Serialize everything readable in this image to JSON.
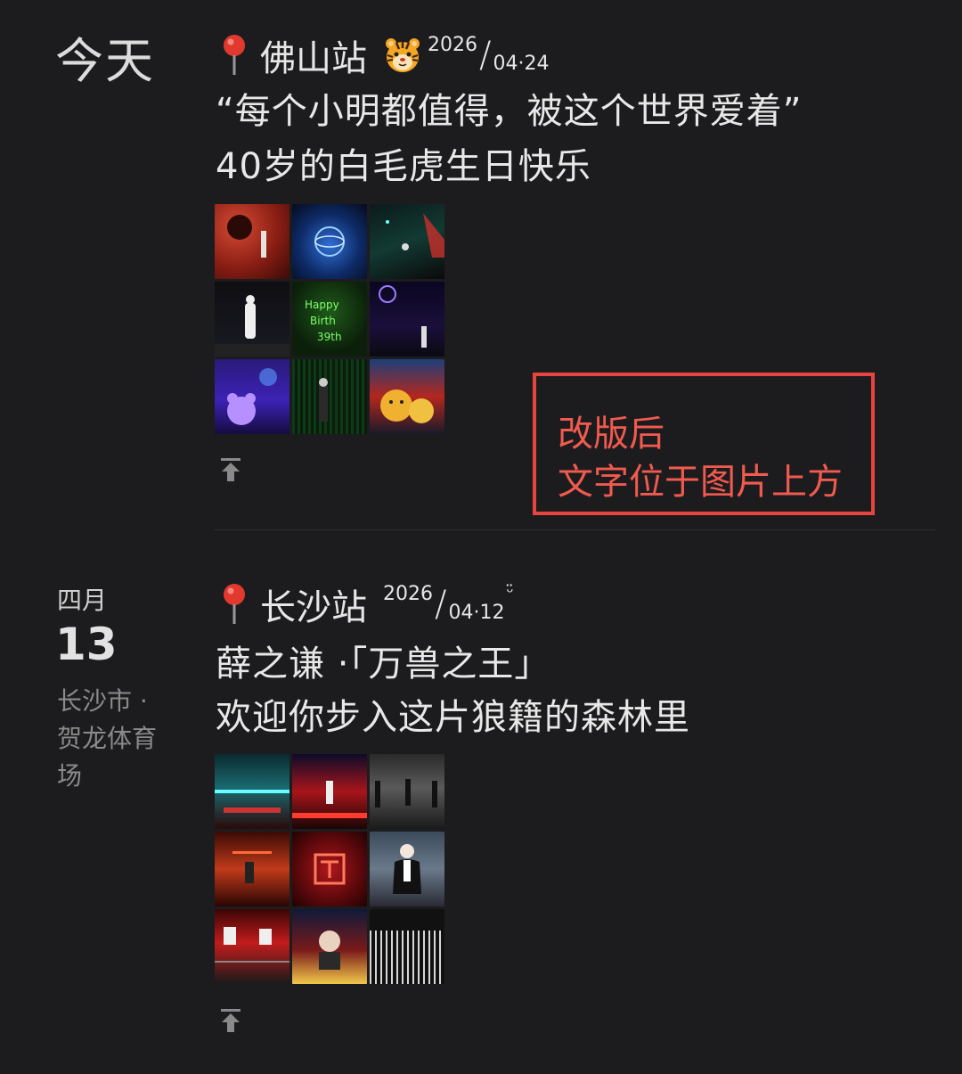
{
  "posts": [
    {
      "date_label": "今天",
      "location": "佛山站",
      "has_tiger": true,
      "year": "2026",
      "slash": "/",
      "month_day": "04·24",
      "line1": "“每个小明都值得，被这个世界爱着”",
      "line2": "40岁的白毛虎生日快乐",
      "photo_icons": [
        "stage-photo-icon",
        "globe-projection-photo-icon",
        "stage-lights-photo-icon",
        "singer-white-outfit-photo-icon",
        "green-laser-text-photo-icon",
        "purple-laser-stage-photo-icon",
        "purple-bear-balloon-photo-icon",
        "green-screen-stage-photo-icon",
        "tiger-mascot-photo-icon"
      ]
    },
    {
      "month": "四月",
      "day": "13",
      "place": "长沙市 · 贺龙体育场",
      "location": "长沙站",
      "year": "2026",
      "slash": "/",
      "month_day": "04·12",
      "smile": "ᵕ̈",
      "line1": "薛之谦 ·「万兽之王」",
      "line2": "欢迎你步入这片狼籍的森林里",
      "photo_icons": [
        "cyan-stage-photo-icon",
        "red-stage-photo-icon",
        "dark-stage-photo-icon",
        "red-band-photo-icon",
        "red-logo-screen-photo-icon",
        "singer-black-suit-photo-icon",
        "red-crowd-photo-icon",
        "performer-closeup-photo-icon",
        "white-light-crowd-photo-icon"
      ]
    }
  ],
  "annotation": {
    "line1": "改版后",
    "line2": "文字位于图片上方",
    "color": "#e8443f"
  },
  "colors": {
    "background": "#1c1c1e",
    "text": "#e6e6e6",
    "muted": "#8a8a8a"
  }
}
